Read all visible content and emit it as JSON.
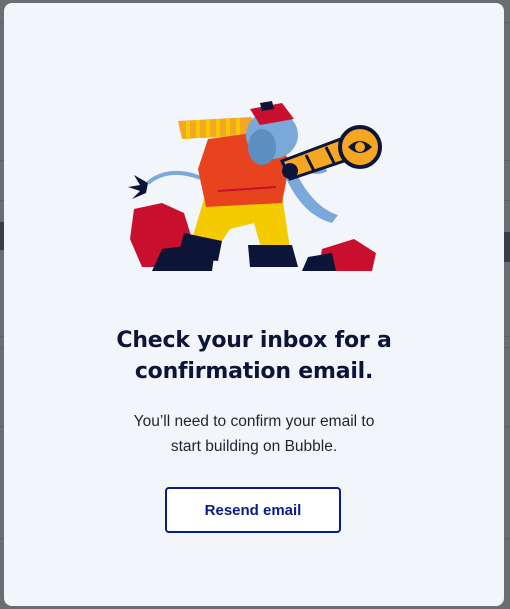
{
  "modal": {
    "heading_line1": "Check your inbox for a",
    "heading_line2": "confirmation email.",
    "body_line1": "You’ll need to confirm your email to",
    "body_line2": "start building on Bubble.",
    "resend_label": "Resend email"
  },
  "illustration": {
    "icon": "elephant-with-spyglass-illustration",
    "colors": {
      "elephant": "#7aa8d8",
      "jacket": "#e8431f",
      "pants": "#f3cb00",
      "scarf": "#f5a623",
      "rocks": "#c8102e",
      "navy": "#0c1438"
    }
  },
  "colors": {
    "accent": "#0a1c8c",
    "heading": "#0c1438",
    "modal_bg": "#f2f5fa",
    "overlay": "#6b6d71"
  }
}
